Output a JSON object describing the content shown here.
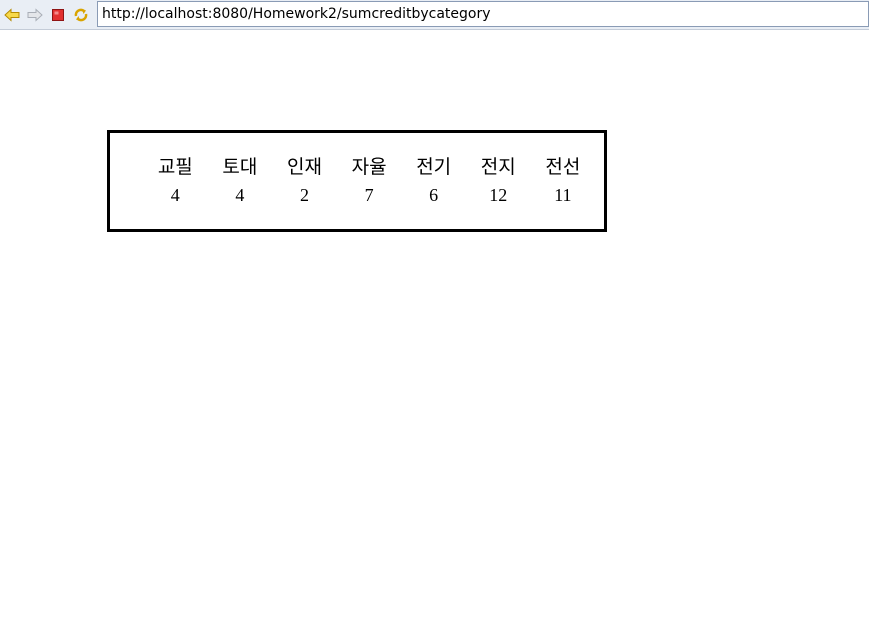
{
  "browser": {
    "url": "http://localhost:8080/Homework2/sumcreditbycategory",
    "buttons": [
      {
        "icon": "back-arrow-icon",
        "color": "#e0b000"
      },
      {
        "icon": "forward-arrow-icon",
        "color": "#b8bcc4"
      },
      {
        "icon": "stop-icon",
        "color": "#d42020"
      },
      {
        "icon": "refresh-icon",
        "color": "#e0b000"
      }
    ]
  },
  "table": {
    "headers": [
      "교필",
      "토대",
      "인재",
      "자율",
      "전기",
      "전지",
      "전선"
    ],
    "values": [
      "4",
      "4",
      "2",
      "7",
      "6",
      "12",
      "11"
    ]
  }
}
